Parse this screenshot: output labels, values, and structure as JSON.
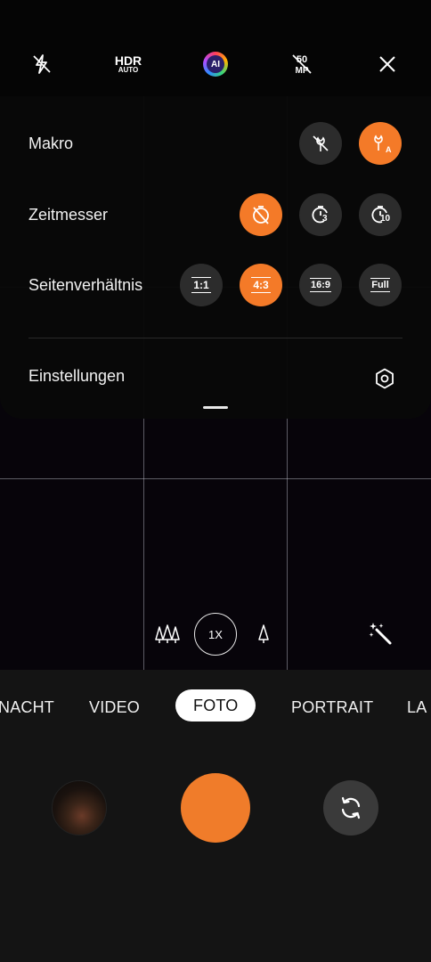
{
  "topbar": {
    "hdr_label": "HDR",
    "hdr_sub": "AUTO",
    "ai_label": "AI",
    "mp_label": "50 MP"
  },
  "panel": {
    "rows": [
      {
        "label": "Makro"
      },
      {
        "label": "Zeitmesser"
      },
      {
        "label": "Seitenverhältnis"
      }
    ],
    "timer_options": [
      "3",
      "10"
    ],
    "ratio_options": [
      "1:1",
      "4:3",
      "16:9",
      "Full"
    ],
    "settings_label": "Einstellungen"
  },
  "zoom": {
    "current": "1X"
  },
  "modes": [
    "NACHT",
    "VIDEO",
    "FOTO",
    "PORTRAIT",
    "LA"
  ],
  "colors": {
    "accent": "#f47a28",
    "selected_mode_bg": "#ffffff"
  }
}
